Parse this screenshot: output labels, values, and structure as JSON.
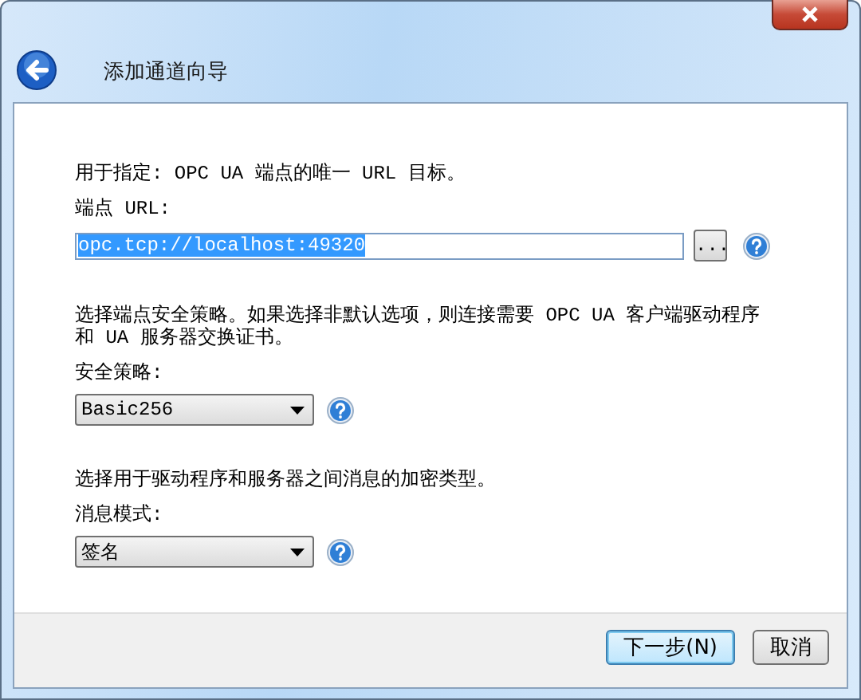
{
  "window": {
    "title": "添加通道向导"
  },
  "sections": [
    {
      "description": "用于指定: OPC UA 端点的唯一 URL 目标。",
      "label": "端点 URL:",
      "kind": "text-field",
      "value": "opc.tcp://localhost:49320",
      "value_selected": true,
      "browse": "..."
    },
    {
      "description": "选择端点安全策略。如果选择非默认选项，则连接需要 OPC UA 客户端驱动程序和 UA 服务器交换证书。",
      "label": "安全策略:",
      "kind": "dropdown",
      "value": "Basic256"
    },
    {
      "description": "选择用于驱动程序和服务器之间消息的加密类型。",
      "label": "消息模式:",
      "kind": "dropdown",
      "value": "签名"
    }
  ],
  "buttons": [
    {
      "label": "下一步(N)",
      "default": true
    },
    {
      "label": "取消",
      "default": false
    }
  ]
}
